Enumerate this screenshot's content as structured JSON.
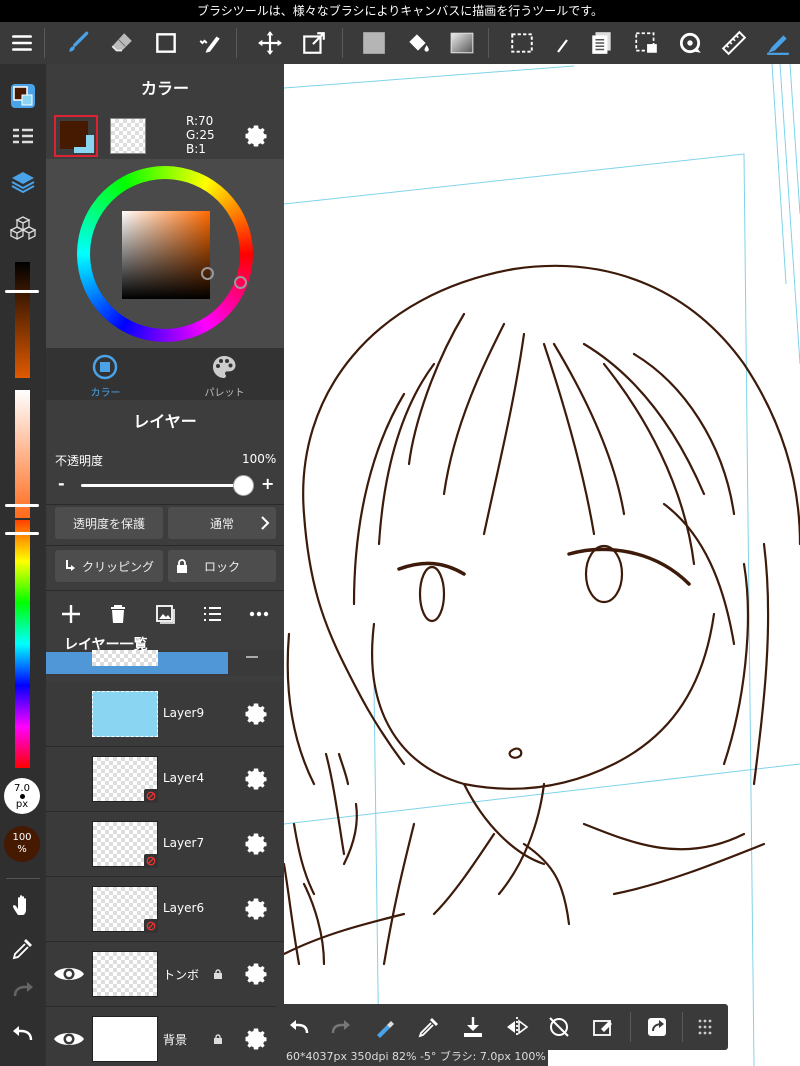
{
  "status_bar": {
    "tooltip": "ブラシツールは、様々なブラシによりキャンバスに描画を行うツールです。"
  },
  "toolbar": {
    "icons": [
      "menu-icon",
      "brush-icon",
      "eraser-icon",
      "rectangle-icon",
      "select-pen-icon",
      "move-icon",
      "transform-icon",
      "fill-color-icon",
      "bucket-icon",
      "gradient-icon",
      "marquee-icon",
      "select-wand-icon",
      "pages-icon",
      "select-layer-icon",
      "rotate-icon",
      "ruler-icon",
      "pen-active-icon"
    ]
  },
  "left_bar": {
    "brush_size": {
      "value": "7.0",
      "unit": "px"
    },
    "opacity": {
      "value": "100",
      "unit": "%"
    },
    "colors": {
      "foreground": "#461901",
      "accent": "#3a8fd6"
    }
  },
  "color_panel": {
    "title": "カラー",
    "rgb": {
      "r": "R:70",
      "g": "G:25",
      "b": "B:1"
    },
    "tabs": [
      {
        "label": "カラー",
        "active": true
      },
      {
        "label": "パレット",
        "active": false
      }
    ]
  },
  "layer_panel": {
    "title": "レイヤー",
    "opacity_label": "不透明度",
    "opacity_value": "100%",
    "opacity_fraction": 1.0,
    "minus": "-",
    "plus": "+",
    "protect_alpha": "透明度を保護",
    "blend_mode": "通常",
    "clipping": "クリッピング",
    "lock": "ロック",
    "list_title": "レイヤー一覧",
    "layers": [
      {
        "name": "Layer9"
      },
      {
        "name": "Layer4"
      },
      {
        "name": "Layer7"
      },
      {
        "name": "Layer6"
      },
      {
        "name": "トンボ"
      },
      {
        "name": "背景"
      }
    ]
  },
  "info_bar": {
    "text": "60*4037px 350dpi 82% -5° ブラシ: 7.0px 100%"
  }
}
